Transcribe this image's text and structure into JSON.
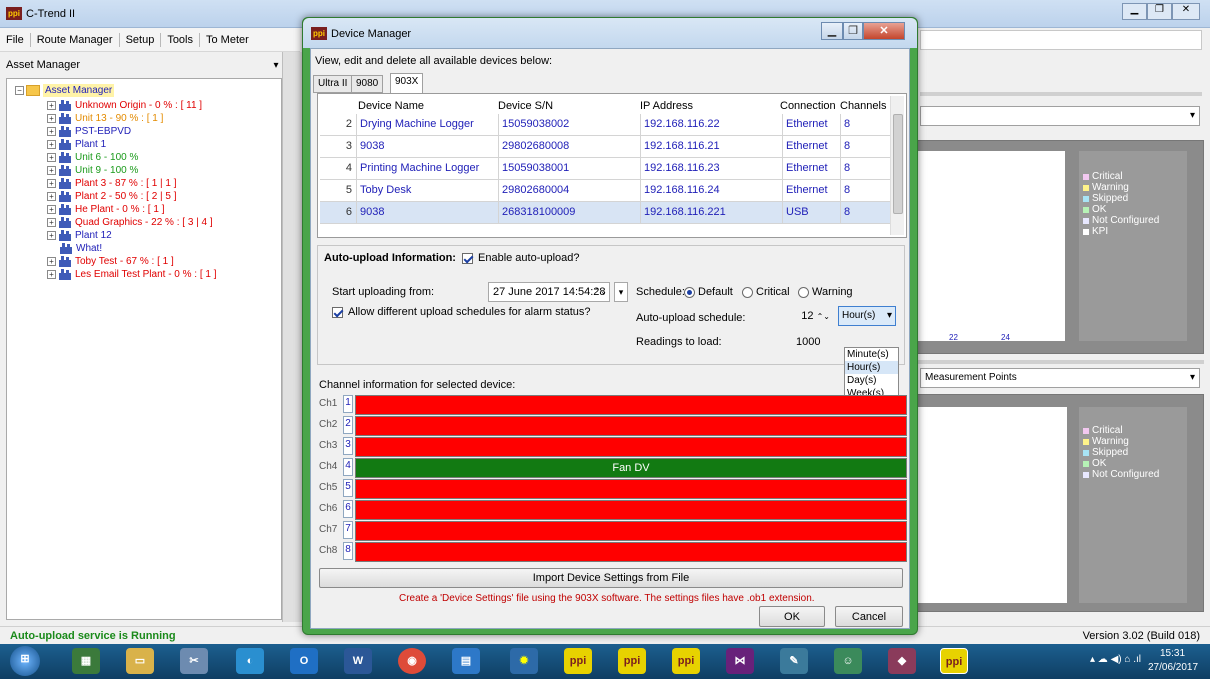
{
  "app": {
    "title": "C-Trend II",
    "version": "Version 3.02 (Build 018)",
    "status": "Auto-upload service is Running"
  },
  "menu": [
    "File",
    "Route Manager",
    "Setup",
    "Tools",
    "To Meter"
  ],
  "asset_manager": {
    "title": "Asset Manager",
    "tree": [
      {
        "label": "Asset Manager",
        "color": "blue",
        "type": "root"
      },
      {
        "label": "Unknown Origin - 0 % : [ 11 ]",
        "color": "red"
      },
      {
        "label": "Unit 13 - 90 % : [ 1 ]",
        "color": "orange"
      },
      {
        "label": "PST-EBPVD",
        "color": "blue"
      },
      {
        "label": "Plant 1",
        "color": "blue"
      },
      {
        "label": "Unit 6 - 100 %",
        "color": "green"
      },
      {
        "label": "Unit 9 - 100 %",
        "color": "green"
      },
      {
        "label": "Plant 3 - 87 % : [ 1 | 1 ]",
        "color": "red"
      },
      {
        "label": "Plant 2 - 50 % : [ 2 | 5 ]",
        "color": "red"
      },
      {
        "label": "He Plant - 0 % : [ 1 ]",
        "color": "red"
      },
      {
        "label": "Quad Graphics - 22 % : [ 3 | 4 ]",
        "color": "red"
      },
      {
        "label": "Plant 12",
        "color": "blue"
      },
      {
        "label": "What!",
        "color": "blue"
      },
      {
        "label": "Toby Test - 67 % : [ 1 ]",
        "color": "red"
      },
      {
        "label": "Les Email Test Plant - 0 % : [ 1 ]",
        "color": "red"
      }
    ]
  },
  "right_panel": {
    "legend_top": [
      "Critical",
      "Warning",
      "Skipped",
      "OK",
      "Not Configured",
      "KPI"
    ],
    "legend_bottom": [
      "Critical",
      "Warning",
      "Skipped",
      "OK",
      "Not Configured"
    ],
    "axis_ticks": [
      "22",
      "24"
    ],
    "combo_bottom": "Measurement Points",
    "legend_colors": [
      "#f2c8f0",
      "#fff38a",
      "#a8e4f5",
      "#b6f2b6",
      "#e8e8ff",
      "#ffffff"
    ]
  },
  "dialog": {
    "title": "Device Manager",
    "intro": "View, edit and delete all available devices below:",
    "tabs": [
      "Ultra II",
      "9080",
      "903X"
    ],
    "columns": [
      "Device Name",
      "Device S/N",
      "IP Address",
      "Connection",
      "Channels"
    ],
    "devices": [
      {
        "n": "2",
        "name": "Drying Machine Logger",
        "sn": "15059038002",
        "ip": "192.168.116.22",
        "conn": "Ethernet",
        "ch": "8"
      },
      {
        "n": "3",
        "name": "9038",
        "sn": "29802680008",
        "ip": "192.168.116.21",
        "conn": "Ethernet",
        "ch": "8"
      },
      {
        "n": "4",
        "name": "Printing Machine Logger",
        "sn": "15059038001",
        "ip": "192.168.116.23",
        "conn": "Ethernet",
        "ch": "8"
      },
      {
        "n": "5",
        "name": "Toby Desk",
        "sn": "29802680004",
        "ip": "192.168.116.24",
        "conn": "Ethernet",
        "ch": "8"
      },
      {
        "n": "6",
        "name": "9038",
        "sn": "268318100009",
        "ip": "192.168.116.221",
        "conn": "USB",
        "ch": "8"
      }
    ],
    "auto": {
      "header": "Auto-upload Information:",
      "enable": "Enable auto-upload?",
      "start_label": "Start uploading from:",
      "start_value": "27 June 2017 14:54:28",
      "schedule_label": "Schedule:",
      "schedule_options": [
        "Default",
        "Critical",
        "Warning"
      ],
      "allow": "Allow different upload schedules for alarm status?",
      "auto_schedule_label": "Auto-upload schedule:",
      "auto_schedule_value": "12",
      "unit": "Hour(s)",
      "unit_options": [
        "Minute(s)",
        "Hour(s)",
        "Day(s)",
        "Week(s)"
      ],
      "readings_label": "Readings to load:",
      "readings_value": "1000"
    },
    "channel_title": "Channel information for selected device:",
    "channels": [
      {
        "label": "Ch1",
        "num": "1",
        "text": "",
        "color": "#ff0000"
      },
      {
        "label": "Ch2",
        "num": "2",
        "text": "",
        "color": "#ff0000"
      },
      {
        "label": "Ch3",
        "num": "3",
        "text": "",
        "color": "#ff0000"
      },
      {
        "label": "Ch4",
        "num": "4",
        "text": "Fan DV",
        "color": "#127a12"
      },
      {
        "label": "Ch5",
        "num": "5",
        "text": "",
        "color": "#ff0000"
      },
      {
        "label": "Ch6",
        "num": "6",
        "text": "",
        "color": "#ff0000"
      },
      {
        "label": "Ch7",
        "num": "7",
        "text": "",
        "color": "#ff0000"
      },
      {
        "label": "Ch8",
        "num": "8",
        "text": "",
        "color": "#ff0000"
      }
    ],
    "import_btn": "Import Device Settings from File",
    "hint": "Create a 'Device Settings' file using the 903X software. The settings files have .ob1 extension.",
    "ok": "OK",
    "cancel": "Cancel"
  },
  "taskbar": {
    "time": "15:31",
    "date": "27/06/2017"
  }
}
